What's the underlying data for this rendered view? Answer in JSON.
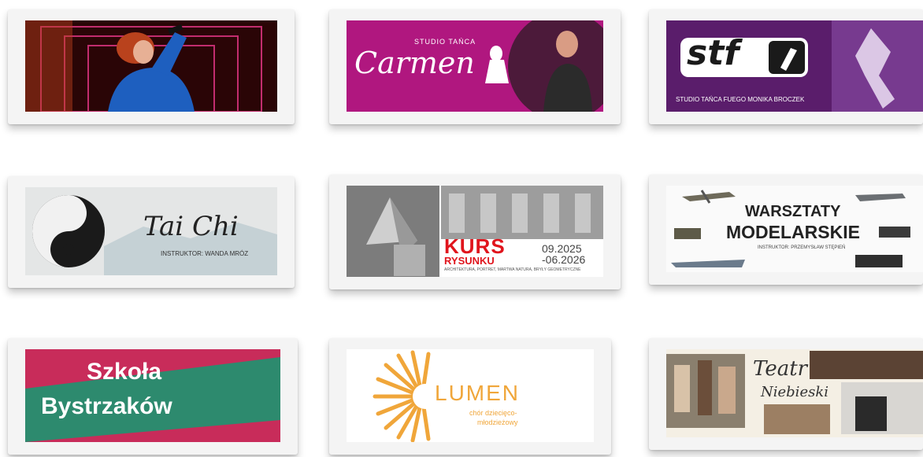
{
  "tiles": [
    {
      "id": "singing",
      "text": ""
    },
    {
      "id": "carmen",
      "subtitle": "STUDIO TAŃCA",
      "title": "Carmen"
    },
    {
      "id": "stf",
      "logo": "stf",
      "subtitle": "STUDIO TAŃCA FUEGO MONIKA BROCZEK"
    },
    {
      "id": "taichi",
      "title": "Tai Chi",
      "subtitle": "INSTRUKTOR: WANDA MRÓZ"
    },
    {
      "id": "kurs",
      "title1": "KURS",
      "title2": "RYSUNKU",
      "date1": "09.2025",
      "date2": "-06.2026",
      "footer": "ARCHITEKTURA, PORTRET, MARTWA NATURA, BRYŁY GEOMETRYCZNE"
    },
    {
      "id": "modelarskie",
      "title1": "WARSZTATY",
      "title2": "MODELARSKIE",
      "subtitle": "INSTRUKTOR: PRZEMYSŁAW STĘPIEŃ"
    },
    {
      "id": "bystrzakow",
      "title1": "Szkoła",
      "title2": "Bystrzaków"
    },
    {
      "id": "lumen",
      "title": "LUMEN",
      "sub1": "chór dziecięco-",
      "sub2": "młodzieżowy"
    },
    {
      "id": "teatr",
      "title1": "Teatr",
      "title2": "Niebieski"
    }
  ],
  "colors": {
    "carmen": "#b0177f",
    "stf": "#5a1d6b",
    "kursRed": "#e0151d",
    "lumen": "#f0a63a",
    "bystrzakPink": "#c82c5a",
    "bystrzakGreen": "#2d8a6e"
  }
}
